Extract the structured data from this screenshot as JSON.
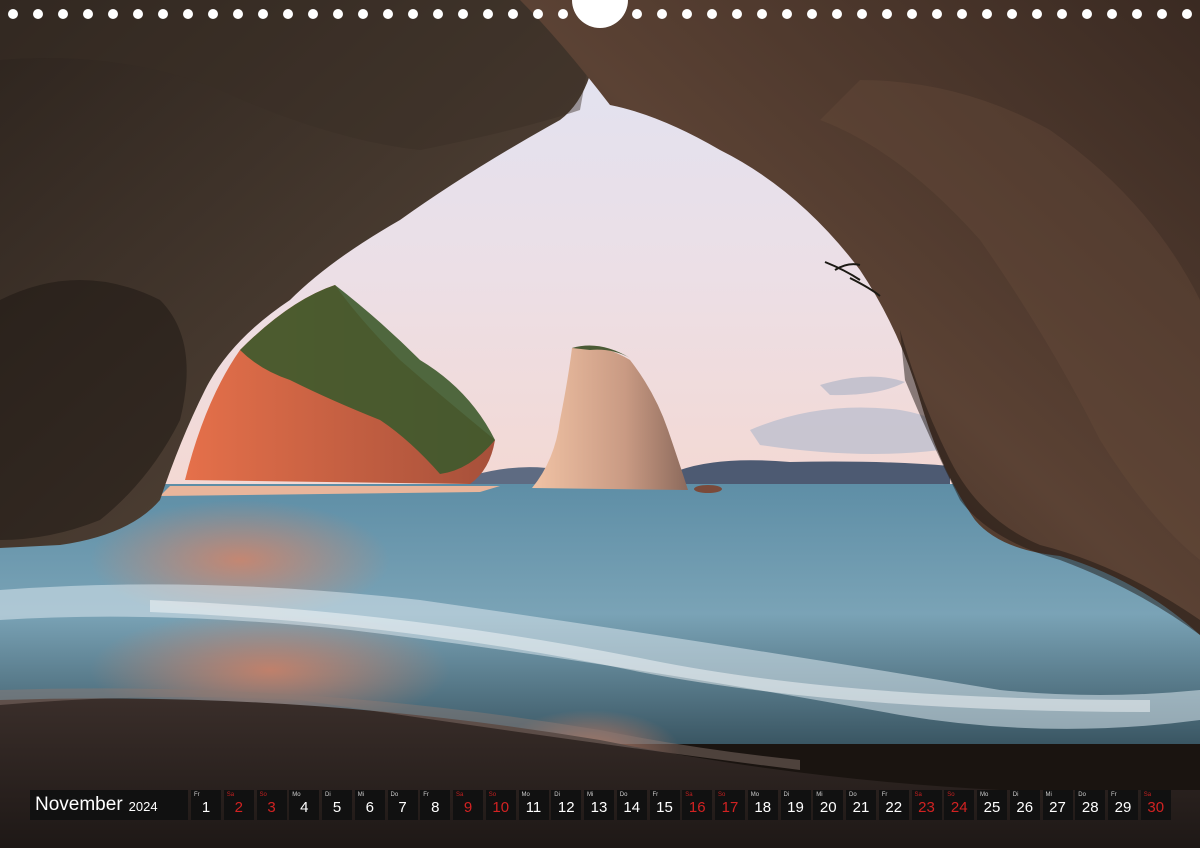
{
  "calendar": {
    "month": "November",
    "year": "2024",
    "days": [
      {
        "wd": "Fr",
        "n": "1",
        "we": false
      },
      {
        "wd": "Sa",
        "n": "2",
        "we": true
      },
      {
        "wd": "So",
        "n": "3",
        "we": true
      },
      {
        "wd": "Mo",
        "n": "4",
        "we": false
      },
      {
        "wd": "Di",
        "n": "5",
        "we": false
      },
      {
        "wd": "Mi",
        "n": "6",
        "we": false
      },
      {
        "wd": "Do",
        "n": "7",
        "we": false
      },
      {
        "wd": "Fr",
        "n": "8",
        "we": false
      },
      {
        "wd": "Sa",
        "n": "9",
        "we": true
      },
      {
        "wd": "So",
        "n": "10",
        "we": true
      },
      {
        "wd": "Mo",
        "n": "11",
        "we": false
      },
      {
        "wd": "Di",
        "n": "12",
        "we": false
      },
      {
        "wd": "Mi",
        "n": "13",
        "we": false
      },
      {
        "wd": "Do",
        "n": "14",
        "we": false
      },
      {
        "wd": "Fr",
        "n": "15",
        "we": false
      },
      {
        "wd": "Sa",
        "n": "16",
        "we": true
      },
      {
        "wd": "So",
        "n": "17",
        "we": true
      },
      {
        "wd": "Mo",
        "n": "18",
        "we": false
      },
      {
        "wd": "Di",
        "n": "19",
        "we": false
      },
      {
        "wd": "Mi",
        "n": "20",
        "we": false
      },
      {
        "wd": "Do",
        "n": "21",
        "we": false
      },
      {
        "wd": "Fr",
        "n": "22",
        "we": false
      },
      {
        "wd": "Sa",
        "n": "23",
        "we": true
      },
      {
        "wd": "So",
        "n": "24",
        "we": true
      },
      {
        "wd": "Mo",
        "n": "25",
        "we": false
      },
      {
        "wd": "Di",
        "n": "26",
        "we": false
      },
      {
        "wd": "Mi",
        "n": "27",
        "we": false
      },
      {
        "wd": "Do",
        "n": "28",
        "we": false
      },
      {
        "wd": "Fr",
        "n": "29",
        "we": false
      },
      {
        "wd": "Sa",
        "n": "30",
        "we": true
      }
    ]
  },
  "colors": {
    "weekend": "#d22222",
    "cell_bg": "#111111",
    "text": "#ffffff"
  }
}
